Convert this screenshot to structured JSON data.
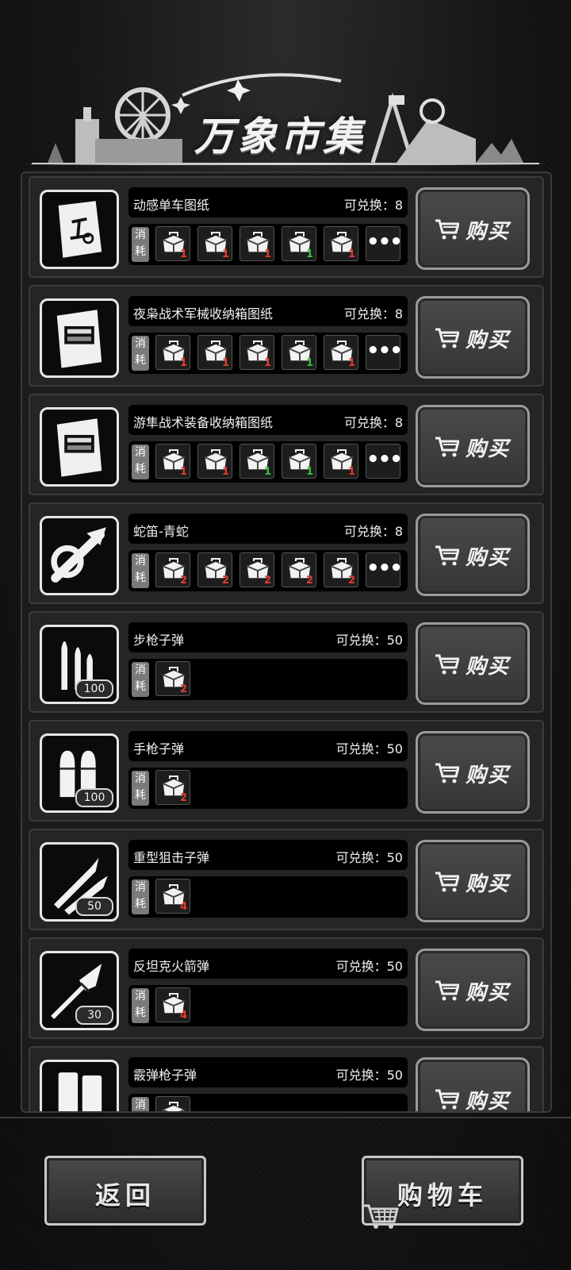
{
  "header": {
    "title": "万象市集"
  },
  "buy_label": "购买",
  "cost_tag": "消耗",
  "items": [
    {
      "name": "动感单车图纸",
      "exchange": "可兑换：8",
      "icon": "blueprint-bike-icon",
      "qty": "",
      "costs": [
        {
          "count": "1",
          "color": "red"
        },
        {
          "count": "1",
          "color": "red"
        },
        {
          "count": "1",
          "color": "red"
        },
        {
          "count": "1",
          "color": "green"
        },
        {
          "count": "1",
          "color": "red"
        }
      ],
      "more": true
    },
    {
      "name": "夜枭战术军械收纳箱图纸",
      "exchange": "可兑换：8",
      "icon": "blueprint-crate-icon",
      "qty": "",
      "costs": [
        {
          "count": "1",
          "color": "red"
        },
        {
          "count": "1",
          "color": "red"
        },
        {
          "count": "1",
          "color": "red"
        },
        {
          "count": "1",
          "color": "green"
        },
        {
          "count": "1",
          "color": "red"
        }
      ],
      "more": true
    },
    {
      "name": "游隼战术装备收纳箱图纸",
      "exchange": "可兑换：8",
      "icon": "blueprint-crate-icon",
      "qty": "",
      "costs": [
        {
          "count": "1",
          "color": "red"
        },
        {
          "count": "1",
          "color": "red"
        },
        {
          "count": "1",
          "color": "green"
        },
        {
          "count": "1",
          "color": "green"
        },
        {
          "count": "1",
          "color": "red"
        }
      ],
      "more": true
    },
    {
      "name": "蛇笛-青蛇",
      "exchange": "可兑换：8",
      "icon": "snake-flute-icon",
      "qty": "",
      "costs": [
        {
          "count": "2",
          "color": "red"
        },
        {
          "count": "2",
          "color": "red"
        },
        {
          "count": "2",
          "color": "red"
        },
        {
          "count": "2",
          "color": "red"
        },
        {
          "count": "2",
          "color": "red"
        }
      ],
      "more": true
    },
    {
      "name": "步枪子弹",
      "exchange": "可兑换：50",
      "icon": "rifle-ammo-icon",
      "qty": "100",
      "costs": [
        {
          "count": "2",
          "color": "red"
        }
      ],
      "more": false
    },
    {
      "name": "手枪子弹",
      "exchange": "可兑换：50",
      "icon": "pistol-ammo-icon",
      "qty": "100",
      "costs": [
        {
          "count": "2",
          "color": "red"
        }
      ],
      "more": false
    },
    {
      "name": "重型狙击子弹",
      "exchange": "可兑换：50",
      "icon": "sniper-ammo-icon",
      "qty": "50",
      "costs": [
        {
          "count": "4",
          "color": "red"
        }
      ],
      "more": false
    },
    {
      "name": "反坦克火箭弹",
      "exchange": "可兑换：50",
      "icon": "rocket-icon",
      "qty": "30",
      "costs": [
        {
          "count": "4",
          "color": "red"
        }
      ],
      "more": false
    },
    {
      "name": "霰弹枪子弹",
      "exchange": "可兑换：50",
      "icon": "shotgun-ammo-icon",
      "qty": "",
      "costs": [
        {
          "count": "",
          "color": "red"
        }
      ],
      "more": false
    }
  ],
  "footer": {
    "back_label": "返回",
    "cart_label": "购物车"
  },
  "colors": {
    "red_count": "#e23b2e",
    "green_count": "#35c13a"
  }
}
